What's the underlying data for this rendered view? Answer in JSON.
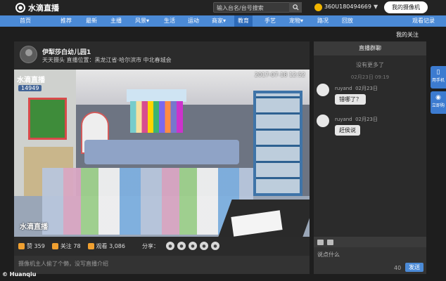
{
  "topbar": {
    "logo_text": "水滴直播",
    "search_placeholder": "输入台名/台号搜索",
    "user_id": "360U180494669",
    "caret": "▼",
    "my_camera": "我的摄像机"
  },
  "nav": {
    "items": [
      "首页",
      "推荐",
      "最新",
      "主播",
      "风景▾",
      "生活",
      "运动",
      "商家▾",
      "教育",
      "手艺",
      "宠物▾",
      "路况",
      "回放"
    ],
    "active": "教育",
    "recent": "观看记录"
  },
  "follow_label": "我的关注",
  "stream": {
    "title": "伊犁莎白幼儿园1",
    "subtitle": "天天摄头   直播位置：黑龙江省·哈尔滨市 中北春城会",
    "video": {
      "watermark_logo": "水滴直播",
      "viewers": "14949",
      "timestamp": "2017-07-18 12:52",
      "watermark_bottom": "水滴直播"
    },
    "stats": {
      "likes_label": "赞 359",
      "follow_label": "关注 78",
      "views_label": "观看 3,086",
      "share_label": "分享："
    },
    "description": "摄像机主人偷了个懒，没写直播介绍"
  },
  "chat": {
    "header": "直播群聊",
    "no_more": "没有更多了",
    "time": "02月23日 09:19",
    "messages": [
      {
        "user": "ruyand",
        "date": "02月23日",
        "text": "错哪了？"
      },
      {
        "user": "ruyand",
        "date": "02月23日",
        "text": "赶侯说"
      }
    ],
    "input_placeholder": "说点什么",
    "char_count": "40",
    "send": "发送"
  },
  "side_tabs": [
    {
      "glyph": "▯",
      "label": "用手机"
    },
    {
      "glyph": "◉",
      "label": "立即购"
    }
  ],
  "credit": "© Huanqiu",
  "colors": {
    "accent": "#4b8ad6",
    "nav_active": "#2d6ab8",
    "background": "#1e1e1e"
  }
}
